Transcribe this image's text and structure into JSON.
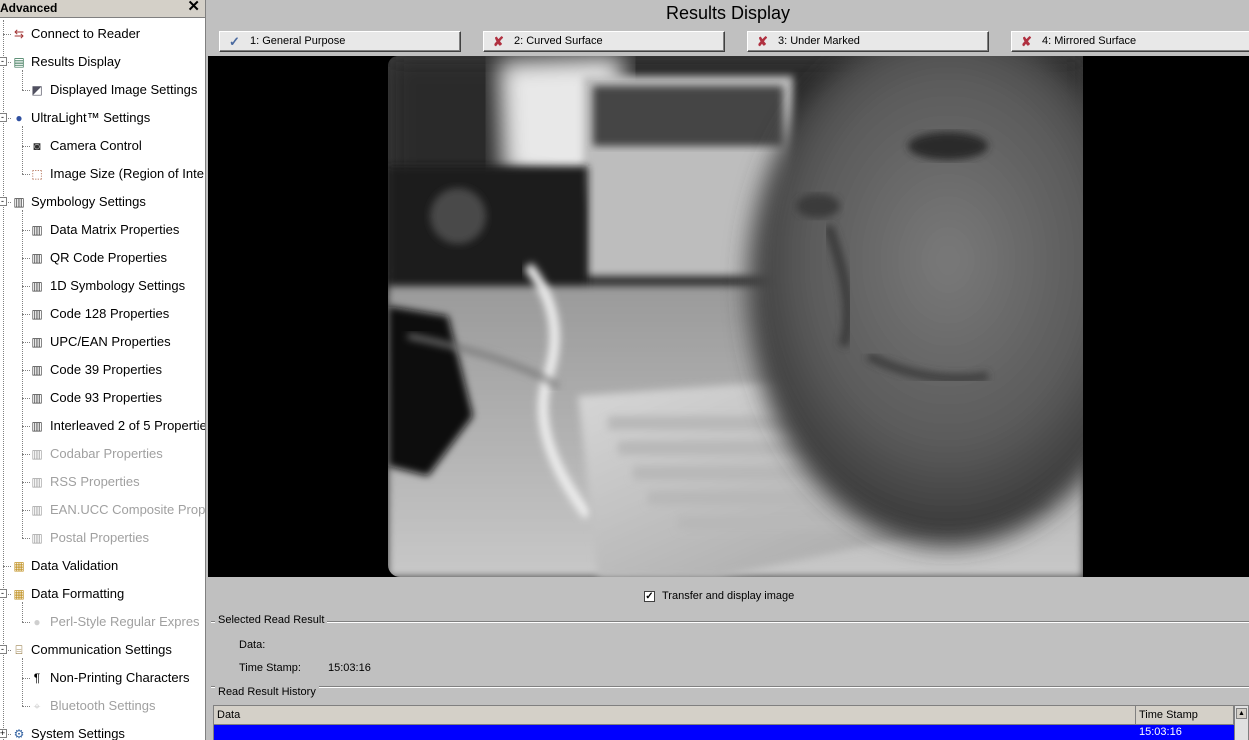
{
  "sidebar": {
    "title": "Advanced",
    "close_glyph": "✕",
    "items": [
      {
        "label": "Connect to Reader",
        "icon": "connect-icon",
        "level": 0,
        "enabled": true
      },
      {
        "label": "Results Display",
        "icon": "display-icon",
        "level": 0,
        "enabled": true,
        "expander": "-"
      },
      {
        "label": "Displayed Image Settings",
        "icon": "image-settings-icon",
        "level": 1,
        "enabled": true
      },
      {
        "label": "UltraLight™ Settings",
        "icon": "ultralight-icon",
        "level": 0,
        "enabled": true,
        "expander": "-"
      },
      {
        "label": "Camera Control",
        "icon": "camera-icon",
        "level": 1,
        "enabled": true
      },
      {
        "label": "Image Size (Region of Inte",
        "icon": "region-icon",
        "level": 1,
        "enabled": true
      },
      {
        "label": "Symbology Settings",
        "icon": "symbology-icon",
        "level": 0,
        "enabled": true,
        "expander": "-"
      },
      {
        "label": "Data Matrix Properties",
        "icon": "symbology-icon",
        "level": 1,
        "enabled": true
      },
      {
        "label": "QR Code Properties",
        "icon": "symbology-icon",
        "level": 1,
        "enabled": true
      },
      {
        "label": "1D Symbology Settings",
        "icon": "symbology-icon",
        "level": 1,
        "enabled": true
      },
      {
        "label": "Code 128 Properties",
        "icon": "symbology-icon",
        "level": 1,
        "enabled": true
      },
      {
        "label": "UPC/EAN Properties",
        "icon": "symbology-icon",
        "level": 1,
        "enabled": true
      },
      {
        "label": "Code 39 Properties",
        "icon": "symbology-icon",
        "level": 1,
        "enabled": true
      },
      {
        "label": "Code 93 Properties",
        "icon": "symbology-icon",
        "level": 1,
        "enabled": true
      },
      {
        "label": "Interleaved 2 of 5 Propertie",
        "icon": "symbology-icon",
        "level": 1,
        "enabled": true
      },
      {
        "label": "Codabar Properties",
        "icon": "symbology-icon",
        "level": 1,
        "enabled": false
      },
      {
        "label": "RSS Properties",
        "icon": "symbology-icon",
        "level": 1,
        "enabled": false
      },
      {
        "label": "EAN.UCC Composite Prop",
        "icon": "symbology-icon",
        "level": 1,
        "enabled": false
      },
      {
        "label": "Postal Properties",
        "icon": "symbology-icon",
        "level": 1,
        "enabled": false
      },
      {
        "label": "Data Validation",
        "icon": "data-validation-icon",
        "level": 0,
        "enabled": true
      },
      {
        "label": "Data Formatting",
        "icon": "data-formatting-icon",
        "level": 0,
        "enabled": true,
        "expander": "-"
      },
      {
        "label": "Perl-Style Regular Expres",
        "icon": "regex-icon",
        "level": 1,
        "enabled": false
      },
      {
        "label": "Communication Settings",
        "icon": "communication-icon",
        "level": 0,
        "enabled": true,
        "expander": "-"
      },
      {
        "label": "Non-Printing Characters",
        "icon": "pilcrow-icon",
        "level": 1,
        "enabled": true
      },
      {
        "label": "Bluetooth Settings",
        "icon": "bluetooth-icon",
        "level": 1,
        "enabled": false
      },
      {
        "label": "System Settings",
        "icon": "system-settings-icon",
        "level": 0,
        "enabled": true,
        "expander": "+"
      }
    ]
  },
  "main": {
    "title": "Results Display",
    "tabs": [
      {
        "label": "1: General Purpose",
        "status": "ok",
        "glyph": "✓"
      },
      {
        "label": "2: Curved Surface",
        "status": "fail",
        "glyph": "✘"
      },
      {
        "label": "3: Under Marked",
        "status": "fail",
        "glyph": "✘"
      },
      {
        "label": "4: Mirrored Surface",
        "status": "fail",
        "glyph": "✘"
      }
    ],
    "transfer": {
      "label": "Transfer and display image",
      "checked": true,
      "check_glyph": "✓"
    },
    "selected_result": {
      "group_title": "Selected Read Result",
      "data_label": "Data:",
      "data_value": "",
      "timestamp_label": "Time Stamp:",
      "timestamp_value": "15:03:16"
    },
    "history": {
      "group_title": "Read Result History",
      "columns": [
        "Data",
        "Time Stamp"
      ],
      "rows": [
        {
          "data": "",
          "timestamp": "15:03:16"
        }
      ],
      "scroll_up_glyph": "▲"
    }
  },
  "colors": {
    "panel_bg": "#c0c0c0",
    "selection": "#0000ff",
    "ok_mark": "#4a6aa0",
    "fail_mark": "#b03040"
  }
}
